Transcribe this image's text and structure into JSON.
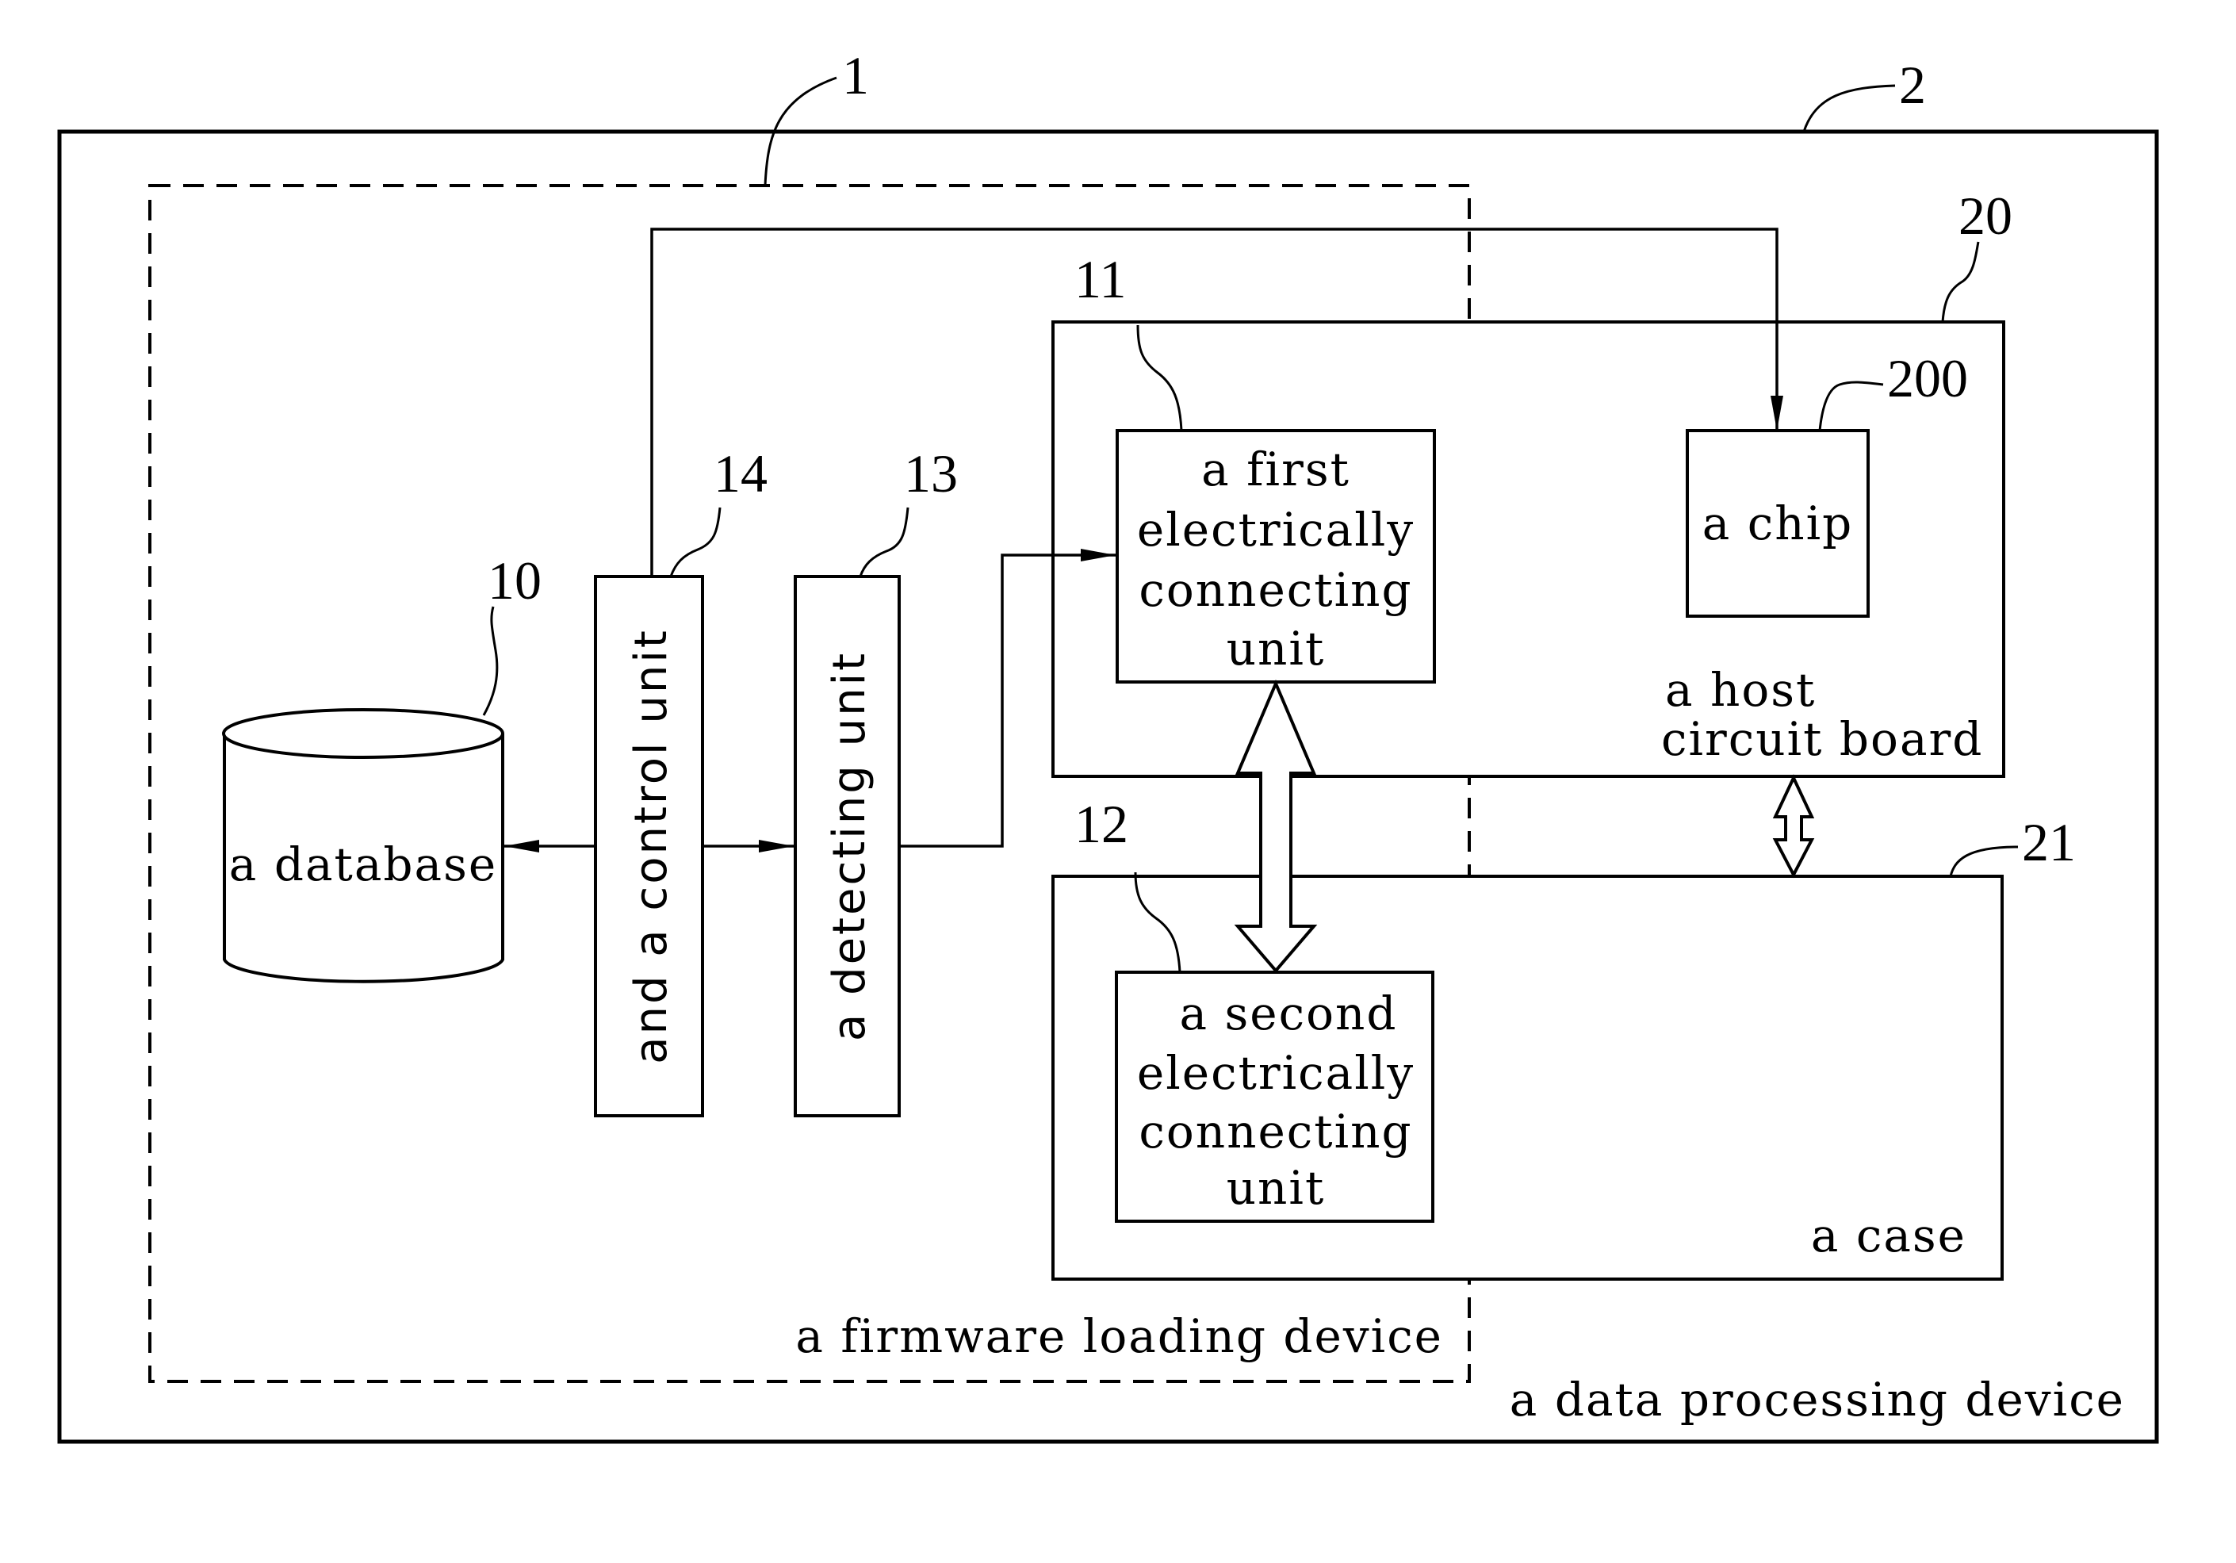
{
  "diagram": {
    "outer_device": {
      "ref": "2",
      "label": "a data processing device"
    },
    "firmware_device": {
      "ref": "1",
      "label": "a firmware loading device"
    },
    "database": {
      "ref": "10",
      "label": "a database"
    },
    "control_unit": {
      "ref": "14",
      "label": "and a control unit"
    },
    "detecting_unit": {
      "ref": "13",
      "label": "a detecting unit"
    },
    "first_unit": {
      "ref": "11",
      "lines": [
        "a first",
        "electrically",
        "connecting",
        "unit"
      ]
    },
    "second_unit": {
      "ref": "12",
      "lines": [
        "a second",
        "electrically",
        "connecting",
        "unit"
      ]
    },
    "host_board": {
      "ref": "20",
      "lines": [
        "a host",
        "circuit board"
      ]
    },
    "chip": {
      "ref": "200",
      "label": "a chip"
    },
    "case": {
      "ref": "21",
      "label": "a case"
    }
  }
}
